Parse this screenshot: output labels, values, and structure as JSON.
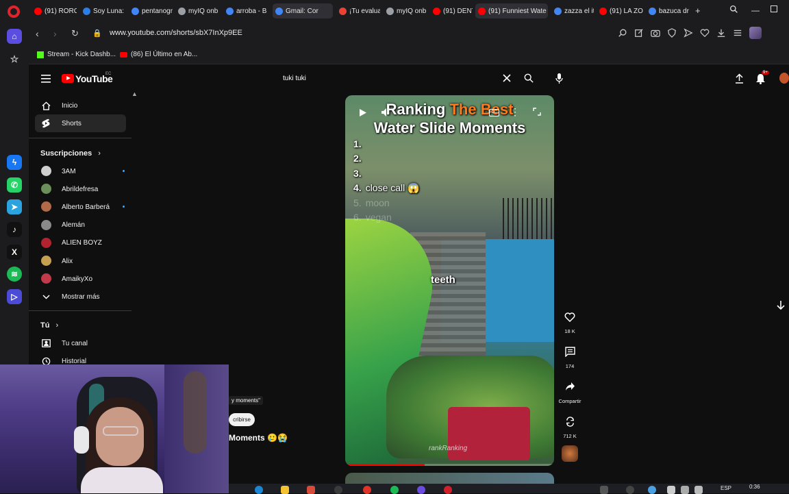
{
  "browser": {
    "url": "www.youtube.com/shorts/sbX7InXp9EE",
    "tabs": [
      {
        "label": "(91) RORO",
        "color": "#ff0000"
      },
      {
        "label": "Soy Luna:",
        "color": "#2b7de9"
      },
      {
        "label": "pentanogr",
        "color": "#4285f4"
      },
      {
        "label": "myIQ onb",
        "color": "#9aa0a6"
      },
      {
        "label": "arroba - B",
        "color": "#4285f4"
      },
      {
        "label": "Gmail: Cor",
        "color": "#4285f4"
      },
      {
        "label": "¡Tu evalua",
        "color": "#ea4335"
      },
      {
        "label": "myIQ onb",
        "color": "#9aa0a6"
      },
      {
        "label": "(91) DENT",
        "color": "#ff0000"
      },
      {
        "label": "(91) Funniest Wate",
        "color": "#ff0000"
      },
      {
        "label": "zazza el it",
        "color": "#4285f4"
      },
      {
        "label": "(91) LA ZO",
        "color": "#ff0000"
      },
      {
        "label": "bazuca dr",
        "color": "#4285f4"
      }
    ],
    "bookmarks": [
      {
        "label": "Stream - Kick Dashb...",
        "color": "#53fc18"
      },
      {
        "label": "(86) El Último en Ab...",
        "color": "#ff0000"
      }
    ],
    "side_apps": [
      {
        "icon": "home-icon",
        "color": "#5b4de0"
      },
      {
        "icon": "star-icon",
        "color": "#3a3a3f"
      },
      {
        "icon": "messenger-icon",
        "color": "#1877f2"
      },
      {
        "icon": "whatsapp-icon",
        "color": "#25d366"
      },
      {
        "icon": "telegram-icon",
        "color": "#2aa3df"
      },
      {
        "icon": "tiktok-icon",
        "color": "#111111"
      },
      {
        "icon": "x-icon",
        "color": "#111111"
      },
      {
        "icon": "spotify-icon",
        "color": "#1db954"
      },
      {
        "icon": "player-icon",
        "color": "#4b4bd8"
      }
    ]
  },
  "youtube": {
    "logo_text": "YouTube",
    "region": "EC",
    "search_query": "tuki tuki",
    "notification_badge": "9+",
    "sidebar": {
      "primary": [
        {
          "label": "Inicio",
          "icon": "home-icon",
          "active": false
        },
        {
          "label": "Shorts",
          "icon": "shorts-icon",
          "active": true
        }
      ],
      "subscriptions_title": "Suscripciones",
      "subscriptions": [
        {
          "label": "3AM",
          "color": "#cfcfcf",
          "dot": true
        },
        {
          "label": "Abrildefresa",
          "color": "#6b8f5a",
          "dot": false
        },
        {
          "label": "Alberto Barberá",
          "color": "#b06a4a",
          "dot": true
        },
        {
          "label": "Alemán",
          "color": "#8a8a8a",
          "dot": false
        },
        {
          "label": "ALIEN BOYZ",
          "color": "#b2232f",
          "dot": false
        },
        {
          "label": "Alix",
          "color": "#c4a050",
          "dot": false
        },
        {
          "label": "AmaikyXo",
          "color": "#c03a4a",
          "dot": false
        }
      ],
      "show_more": "Mostrar más",
      "you_title": "Tú",
      "you_items": [
        {
          "label": "Tu canal",
          "icon": "channel-icon"
        },
        {
          "label": "Historial",
          "icon": "history-icon"
        }
      ]
    },
    "short": {
      "title_line1_a": "Ranking ",
      "title_line1_b": "The Best",
      "title_line2": "Water Slide Moments",
      "ranks": [
        {
          "n": "1.",
          "text": "",
          "faded": false
        },
        {
          "n": "2.",
          "text": "",
          "faded": false
        },
        {
          "n": "3.",
          "text": "",
          "faded": false
        },
        {
          "n": "4.",
          "text": "close call 😱",
          "faded": false
        },
        {
          "n": "5.",
          "text": "moon",
          "faded": true
        },
        {
          "n": "6.",
          "text": "vegan",
          "faded": true
        }
      ],
      "caption": "teeth",
      "watermark": "rankRanking",
      "progress": 0.38,
      "accent_color": "#ff7a1a"
    },
    "actions": {
      "likes": "18 K",
      "comments": "174",
      "share": "Compartir",
      "remix": "712 K"
    },
    "description": {
      "chip": "y moments\"",
      "subscribe": "cribirse",
      "title": "Moments 🥲😭"
    }
  },
  "taskbar": {
    "language": "ESP",
    "time": "0:36"
  }
}
